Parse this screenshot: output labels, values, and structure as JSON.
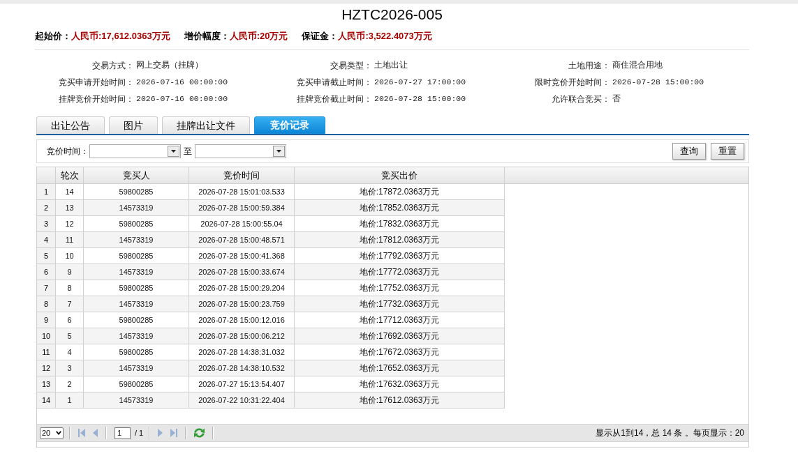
{
  "title": "HZTC2026-005",
  "price_summary": [
    {
      "label": "起始价：",
      "value": "人民币:17,612.0363万元"
    },
    {
      "label": "增价幅度：",
      "value": "人民币:20万元"
    },
    {
      "label": "保证金：",
      "value": "人民币:3,522.4073万元"
    }
  ],
  "details": [
    {
      "label": "交易方式：",
      "value": "网上交易（挂牌）"
    },
    {
      "label": "交易类型：",
      "value": "土地出让"
    },
    {
      "label": "土地用途：",
      "value": "商住混合用地"
    },
    {
      "label": "竞买申请开始时间：",
      "value": "2026-07-16 00:00:00"
    },
    {
      "label": "竞买申请截止时间：",
      "value": "2026-07-27 17:00:00"
    },
    {
      "label": "限时竞价开始时间：",
      "value": "2026-07-28 15:00:00"
    },
    {
      "label": "挂牌竞价开始时间：",
      "value": "2026-07-16 00:00:00"
    },
    {
      "label": "挂牌竞价截止时间：",
      "value": "2026-07-28 15:00:00"
    },
    {
      "label": "允许联合竞买：",
      "value": "否"
    }
  ],
  "tabs": [
    {
      "label": "出让公告",
      "selected": false
    },
    {
      "label": "图片",
      "selected": false
    },
    {
      "label": "挂牌出让文件",
      "selected": false
    },
    {
      "label": "竞价记录",
      "selected": true
    }
  ],
  "filter": {
    "label": "竞价时间：",
    "from_field": {
      "kind": "dropdown"
    },
    "separator": "至",
    "to_field": {
      "kind": "dropdown"
    },
    "buttons": [
      "查询",
      "重置"
    ]
  },
  "table": {
    "columns": [
      "轮次",
      "竞买人",
      "竞价时间",
      "竞买出价"
    ],
    "rows": [
      {
        "row_number": "1",
        "cells": [
          "14",
          "59800285",
          "2026-07-28 15:01:03.533",
          "地价:17872.0363万元"
        ]
      },
      {
        "row_number": "2",
        "cells": [
          "13",
          "14573319",
          "2026-07-28 15:00:59.384",
          "地价:17852.0363万元"
        ]
      },
      {
        "row_number": "3",
        "cells": [
          "12",
          "59800285",
          "2026-07-28 15:00:55.04",
          "地价:17832.0363万元"
        ]
      },
      {
        "row_number": "4",
        "cells": [
          "11",
          "14573319",
          "2026-07-28 15:00:48.571",
          "地价:17812.0363万元"
        ]
      },
      {
        "row_number": "5",
        "cells": [
          "10",
          "59800285",
          "2026-07-28 15:00:41.368",
          "地价:17792.0363万元"
        ]
      },
      {
        "row_number": "6",
        "cells": [
          "9",
          "14573319",
          "2026-07-28 15:00:33.674",
          "地价:17772.0363万元"
        ]
      },
      {
        "row_number": "7",
        "cells": [
          "8",
          "59800285",
          "2026-07-28 15:00:29.204",
          "地价:17752.0363万元"
        ]
      },
      {
        "row_number": "8",
        "cells": [
          "7",
          "14573319",
          "2026-07-28 15:00:23.759",
          "地价:17732.0363万元"
        ]
      },
      {
        "row_number": "9",
        "cells": [
          "6",
          "59800285",
          "2026-07-28 15:00:12.016",
          "地价:17712.0363万元"
        ]
      },
      {
        "row_number": "10",
        "cells": [
          "5",
          "14573319",
          "2026-07-28 15:00:06.212",
          "地价:17692.0363万元"
        ]
      },
      {
        "row_number": "11",
        "cells": [
          "4",
          "59800285",
          "2026-07-28 14:38:31.032",
          "地价:17672.0363万元"
        ]
      },
      {
        "row_number": "12",
        "cells": [
          "3",
          "14573319",
          "2026-07-28 14:38:10.532",
          "地价:17652.0363万元"
        ]
      },
      {
        "row_number": "13",
        "cells": [
          "2",
          "59800285",
          "2026-07-27 15:13:54.407",
          "地价:17632.0363万元"
        ]
      },
      {
        "row_number": "14",
        "cells": [
          "1",
          "14573319",
          "2026-07-22 10:31:22.404",
          "地价:17612.0363万元"
        ]
      }
    ]
  },
  "pagination": {
    "page_size": "20",
    "page": "1",
    "page_total": "/ 1",
    "summary": "显示从1到14，总 14 条 。每页显示：20"
  }
}
